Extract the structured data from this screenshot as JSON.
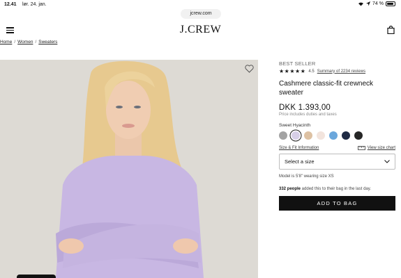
{
  "status": {
    "time": "12.41",
    "date": "lør. 24. jan.",
    "battery": "74 %"
  },
  "browser": {
    "url": "jcrew.com"
  },
  "header": {
    "logo": "J.CREW"
  },
  "breadcrumb": {
    "items": [
      "Home",
      "Women",
      "Sweaters"
    ],
    "separator": "/"
  },
  "product": {
    "badge": "BEST SELLER",
    "stars": "★★★★★",
    "rating": "4.5",
    "reviews_link": "Summary of 2234 reviews",
    "title": "Cashmere classic-fit crewneck sweater",
    "price": "DKK 1.393,00",
    "price_note": "Price includes duties and taxes",
    "color_name": "Sweet Hyacinth",
    "swatches": [
      "#a3a3a3",
      "#d7cfe7",
      "#ddc1a3",
      "#f2e4dd",
      "#6ba7dc",
      "#1f2a44",
      "#262626"
    ],
    "selected_swatch": 1,
    "size_fit_link": "Size & Fit Information",
    "size_chart_link": "View size chart",
    "size_select_placeholder": "Select a size",
    "model_note": "Model is 5'8\" wearing size XS",
    "bag_count": "332 people",
    "bag_note": " added this to their bag in the last day.",
    "add_to_bag": "ADD TO BAG"
  }
}
